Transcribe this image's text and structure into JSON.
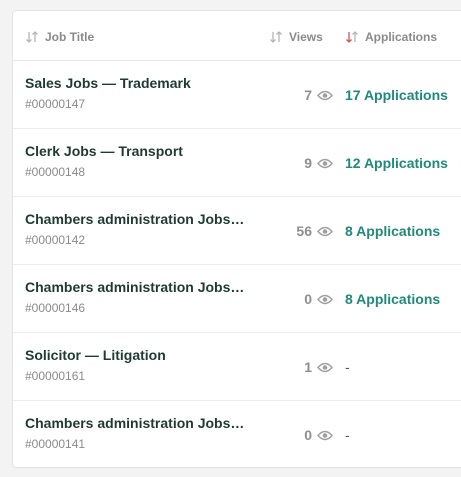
{
  "columns": {
    "job_title": "Job Title",
    "views": "Views",
    "applications": "Applications"
  },
  "rows": [
    {
      "title": "Sales Jobs — Trademark",
      "id": "#00000147",
      "views": "7",
      "applications": "17 Applications"
    },
    {
      "title": "Clerk Jobs — Transport",
      "id": "#00000148",
      "views": "9",
      "applications": "12 Applications"
    },
    {
      "title": "Chambers administration Jobs —…",
      "id": "#00000142",
      "views": "56",
      "applications": "8 Applications"
    },
    {
      "title": "Chambers administration Jobs —…",
      "id": "#00000146",
      "views": "0",
      "applications": "8 Applications"
    },
    {
      "title": "Solicitor — Litigation",
      "id": "#00000161",
      "views": "1",
      "applications": "-"
    },
    {
      "title": "Chambers administration Jobs —…",
      "id": "#00000141",
      "views": "0",
      "applications": "-"
    }
  ],
  "colors": {
    "accent": "#1f8a7c",
    "sort_active": "#d9534f"
  }
}
